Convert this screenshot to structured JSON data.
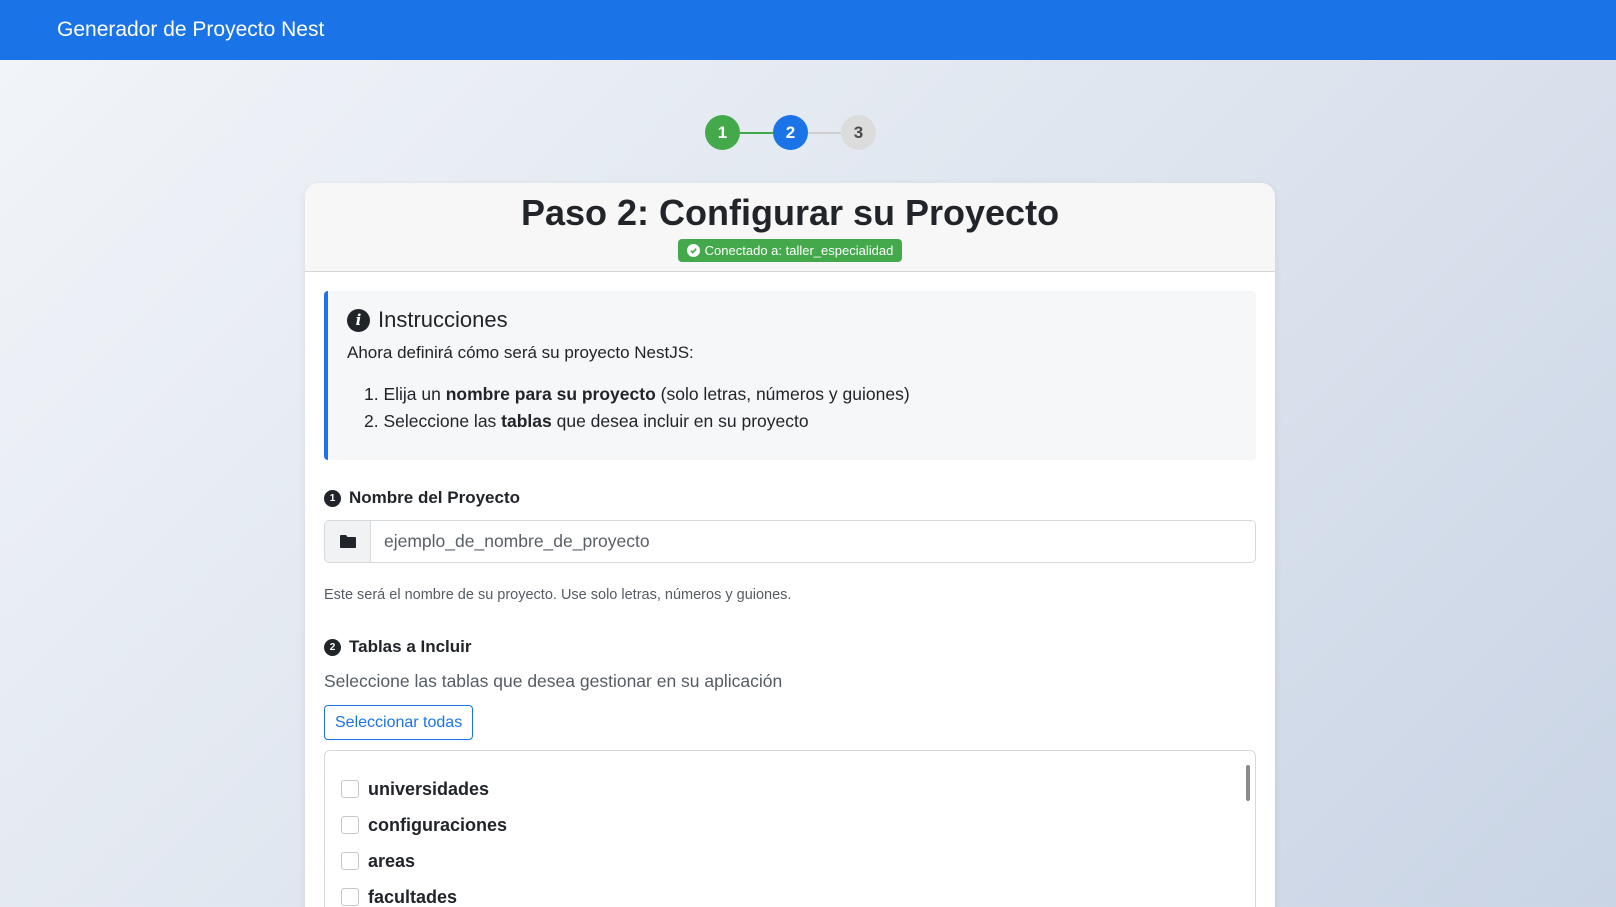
{
  "navbar": {
    "title": "Generador de Proyecto Nest"
  },
  "stepper": {
    "steps": [
      "1",
      "2",
      "3"
    ]
  },
  "card": {
    "title": "Paso 2: Configurar su Proyecto",
    "connection_badge": "Conectado a: taller_especialidad"
  },
  "instructions": {
    "title": "Instrucciones",
    "intro": "Ahora definirá cómo será su proyecto NestJS:",
    "item1_prefix": "1. Elija un ",
    "item1_bold": "nombre para su proyecto",
    "item1_suffix": " (solo letras, números y guiones)",
    "item2_prefix": "2. Seleccione las ",
    "item2_bold": "tablas",
    "item2_suffix": " que desea incluir en su proyecto"
  },
  "project_name": {
    "number": "1",
    "label": "Nombre del Proyecto",
    "placeholder": "ejemplo_de_nombre_de_proyecto",
    "help": "Este será el nombre de su proyecto. Use solo letras, números y guiones."
  },
  "tables": {
    "number": "2",
    "label": "Tablas a Incluir",
    "description": "Seleccione las tablas que desea gestionar en su aplicación",
    "select_all_label": "Seleccionar todas",
    "items": [
      "universidades",
      "configuraciones",
      "areas",
      "facultades"
    ]
  },
  "colors": {
    "primary": "#1a74e8",
    "success": "#43a94b"
  }
}
